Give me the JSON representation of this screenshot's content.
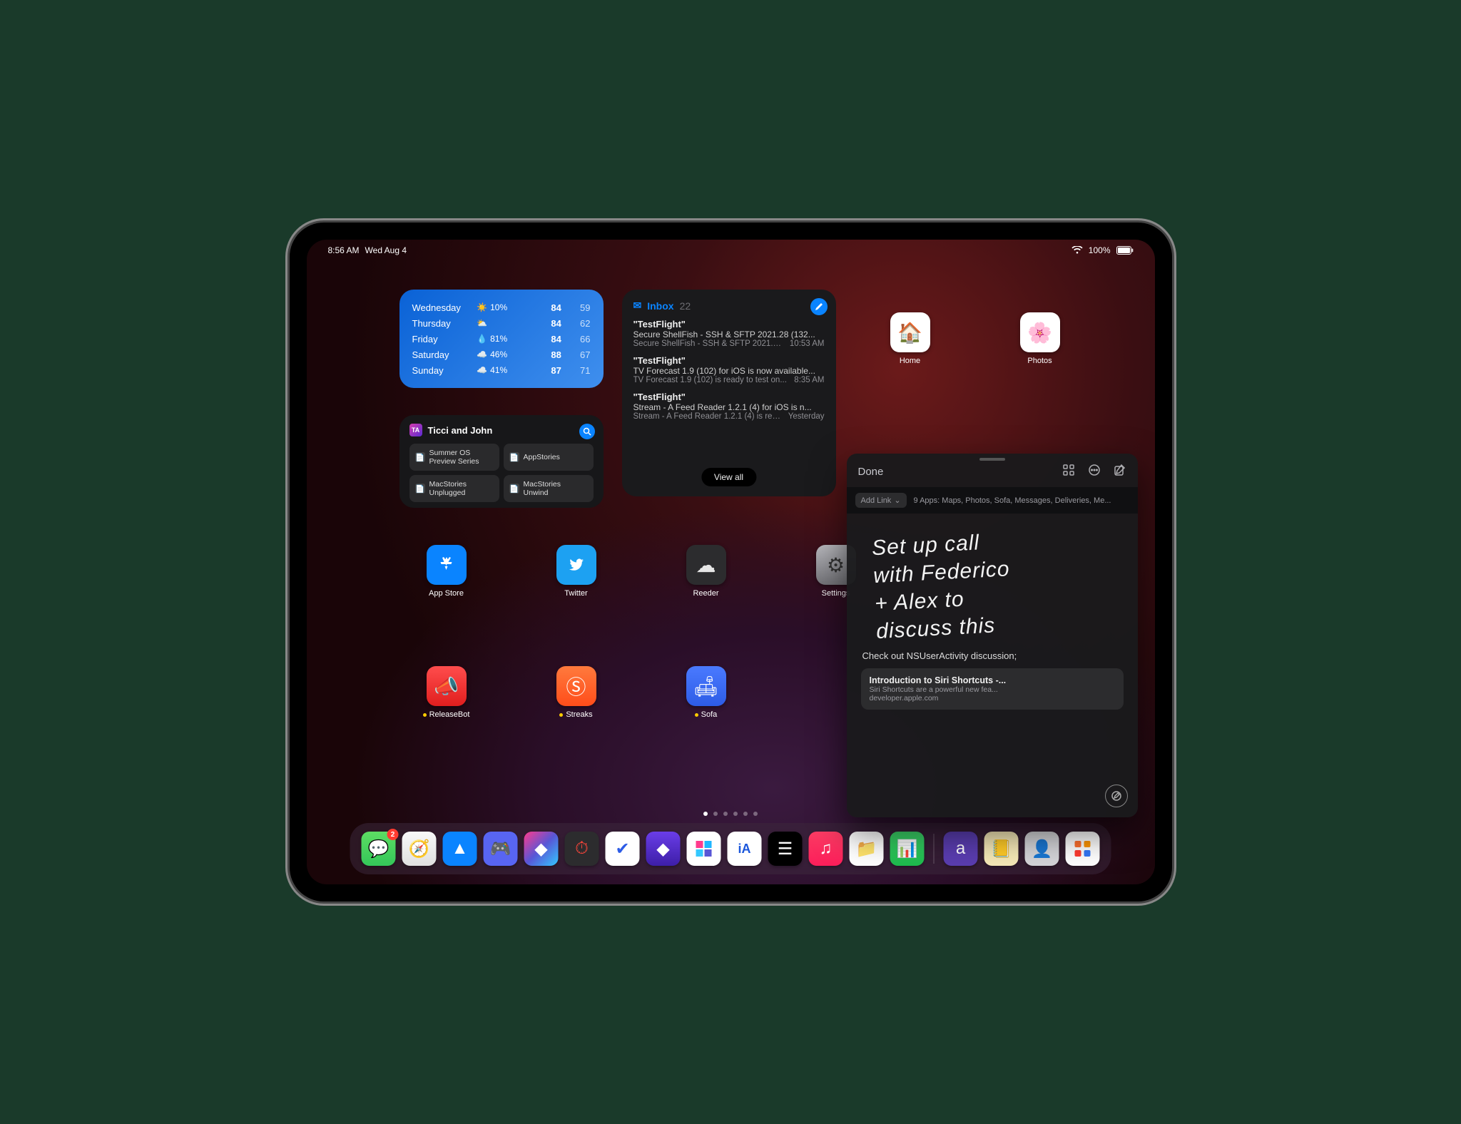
{
  "status": {
    "time": "8:56 AM",
    "date": "Wed Aug 4",
    "battery": "100%"
  },
  "weather": {
    "days": [
      {
        "day": "Wednesday",
        "cond": "☀️",
        "pct": "10%",
        "hi": "84",
        "lo": "59"
      },
      {
        "day": "Thursday",
        "cond": "⛅",
        "pct": "",
        "hi": "84",
        "lo": "62"
      },
      {
        "day": "Friday",
        "cond": "💧",
        "pct": "81%",
        "hi": "84",
        "lo": "66"
      },
      {
        "day": "Saturday",
        "cond": "☁️",
        "pct": "46%",
        "hi": "88",
        "lo": "67"
      },
      {
        "day": "Sunday",
        "cond": "☁️",
        "pct": "41%",
        "hi": "87",
        "lo": "71"
      }
    ]
  },
  "mail": {
    "title": "Inbox",
    "count": "22",
    "viewall": "View all",
    "items": [
      {
        "from": "\"TestFlight\"",
        "subj": "Secure ShellFish - SSH & SFTP 2021.28 (132...",
        "prev": "Secure ShellFish - SSH & SFTP 2021.28...",
        "time": "10:53 AM"
      },
      {
        "from": "\"TestFlight\"",
        "subj": "TV Forecast 1.9 (102) for iOS is now available...",
        "prev": "TV Forecast 1.9 (102) is ready to test on...",
        "time": "8:35 AM"
      },
      {
        "from": "\"TestFlight\"",
        "subj": "Stream - A Feed Reader 1.2.1 (4) for iOS is n...",
        "prev": "Stream - A Feed Reader 1.2.1 (4) is rea...",
        "time": "Yesterday"
      }
    ]
  },
  "notes_widget": {
    "avatar": "TA",
    "title": "Ticci and John",
    "cells": [
      "Summer OS Preview Series",
      "AppStories",
      "MacStories Unplugged",
      "MacStories Unwind"
    ]
  },
  "apps": {
    "home": "Home",
    "photos": "Photos",
    "appstore": "App Store",
    "twitter": "Twitter",
    "reeder": "Reeder",
    "settings": "Settings",
    "releasebot": "ReleaseBot",
    "streaks": "Streaks",
    "sofa": "Sofa"
  },
  "dock_badge_messages": "2",
  "quicknote": {
    "done": "Done",
    "addlink": "Add Link",
    "apps_hint": "9 Apps: Maps, Photos, Sofa, Messages, Deliveries, Me...",
    "hw_l1": "Set up call",
    "hw_l2": "with Federico",
    "hw_l3": "+ Alex to",
    "hw_l4": "discuss this",
    "text": "Check out NSUserActivity discussion;",
    "card_title": "Introduction to Siri Shortcuts -...",
    "card_sub": "Siri Shortcuts are a powerful new fea...",
    "card_domain": "developer.apple.com"
  }
}
